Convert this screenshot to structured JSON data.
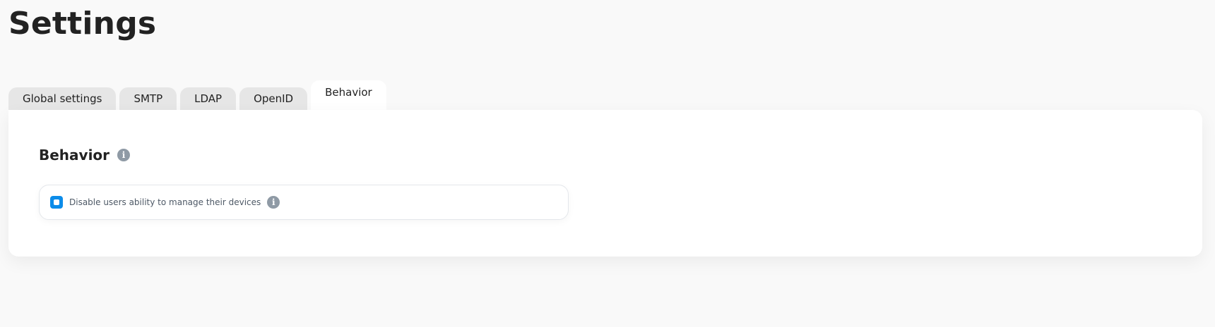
{
  "page": {
    "title": "Settings"
  },
  "tabs": [
    {
      "label": "Global settings",
      "active": false
    },
    {
      "label": "SMTP",
      "active": false
    },
    {
      "label": "LDAP",
      "active": false
    },
    {
      "label": "OpenID",
      "active": false
    },
    {
      "label": "Behavior",
      "active": true
    }
  ],
  "behavior": {
    "title": "Behavior",
    "info_glyph": "i",
    "options": [
      {
        "label": "Disable users ability to manage their devices",
        "checked": true,
        "info_glyph": "i"
      }
    ]
  },
  "colors": {
    "background": "#f9f9f9",
    "tab_inactive": "#e6e6e6",
    "card": "#ffffff",
    "checkbox_accent": "#0c8ce9",
    "info_icon": "#8f9aa5"
  },
  "icons": {
    "section_info": "info-icon",
    "option_info": "info-icon",
    "checkbox": "checkbox-checked-icon"
  }
}
